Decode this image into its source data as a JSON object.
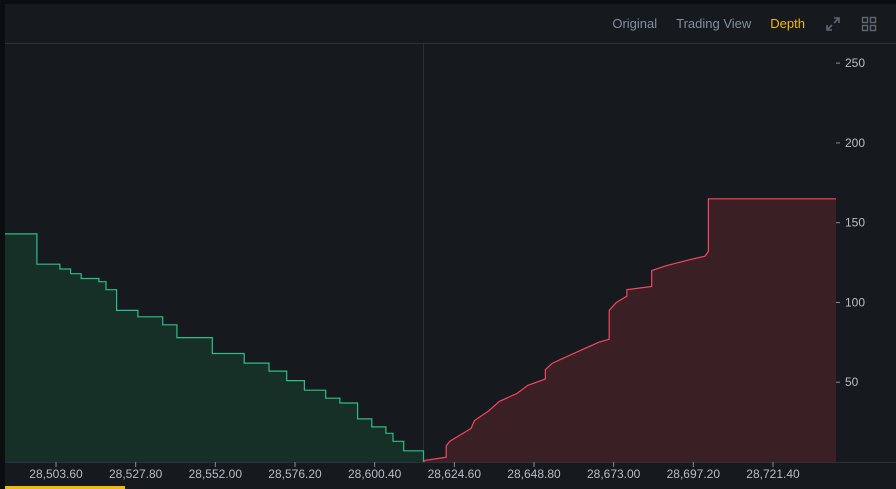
{
  "toolbar": {
    "tabs": [
      {
        "label": "Original",
        "active": false
      },
      {
        "label": "Trading View",
        "active": false
      },
      {
        "label": "Depth",
        "active": true
      }
    ],
    "icons": [
      "expand-icon",
      "grid-layout-icon"
    ]
  },
  "colors": {
    "background": "#161a1e",
    "bid_line": "#2ebd85",
    "bid_fill": "#163028",
    "ask_line": "#f6465d",
    "ask_fill": "#3a1f25",
    "accent": "#f0b90b"
  },
  "chart_data": {
    "type": "area",
    "title": "",
    "xlabel": "",
    "ylabel": "",
    "x_ticks": [
      "28,503.60",
      "28,527.80",
      "28,552.00",
      "28,576.20",
      "28,600.40",
      "28,624.60",
      "28,648.80",
      "28,673.00",
      "28,697.20",
      "28,721.40"
    ],
    "y_ticks": [
      50,
      100,
      150,
      200,
      250
    ],
    "xlim": [
      28495.5,
      28730.0
    ],
    "ylim": [
      0,
      262
    ],
    "mid_price": 28613.6,
    "grid": false,
    "series": [
      {
        "side": "bid",
        "points": [
          [
            28495.5,
            143
          ],
          [
            28504.5,
            143
          ],
          [
            28504.5,
            124
          ],
          [
            28511,
            124
          ],
          [
            28511,
            121
          ],
          [
            28514,
            121
          ],
          [
            28514,
            118
          ],
          [
            28517,
            118
          ],
          [
            28517,
            115
          ],
          [
            28522,
            115
          ],
          [
            28522,
            113
          ],
          [
            28524,
            113
          ],
          [
            28524,
            108
          ],
          [
            28527,
            108
          ],
          [
            28527,
            95
          ],
          [
            28533,
            95
          ],
          [
            28533,
            91
          ],
          [
            28540,
            91
          ],
          [
            28540,
            86
          ],
          [
            28544,
            86
          ],
          [
            28544,
            78
          ],
          [
            28554,
            78
          ],
          [
            28554,
            68
          ],
          [
            28563,
            68
          ],
          [
            28563,
            62
          ],
          [
            28570,
            62
          ],
          [
            28570,
            57
          ],
          [
            28575,
            57
          ],
          [
            28575,
            51
          ],
          [
            28580,
            51
          ],
          [
            28580,
            45
          ],
          [
            28586,
            45
          ],
          [
            28586,
            40
          ],
          [
            28590,
            40
          ],
          [
            28590,
            37
          ],
          [
            28595,
            37
          ],
          [
            28595,
            27
          ],
          [
            28599,
            27
          ],
          [
            28599,
            22
          ],
          [
            28603,
            22
          ],
          [
            28603,
            18
          ],
          [
            28605,
            18
          ],
          [
            28605,
            13
          ],
          [
            28608,
            13
          ],
          [
            28608,
            7
          ],
          [
            28613.6,
            7
          ],
          [
            28613.6,
            0
          ]
        ]
      },
      {
        "side": "ask",
        "points": [
          [
            28613.6,
            0
          ],
          [
            28614,
            1
          ],
          [
            28620,
            3
          ],
          [
            28620,
            10
          ],
          [
            28621,
            13
          ],
          [
            28624,
            17
          ],
          [
            28627,
            21
          ],
          [
            28628,
            26
          ],
          [
            28632,
            32
          ],
          [
            28635,
            38
          ],
          [
            28640,
            43
          ],
          [
            28643,
            48
          ],
          [
            28648,
            52
          ],
          [
            28648,
            58
          ],
          [
            28650,
            62
          ],
          [
            28655,
            67
          ],
          [
            28660,
            72
          ],
          [
            28663,
            75
          ],
          [
            28666,
            77
          ],
          [
            28666,
            95
          ],
          [
            28668,
            100
          ],
          [
            28671,
            104
          ],
          [
            28671,
            108
          ],
          [
            28678,
            110
          ],
          [
            28678,
            120
          ],
          [
            28682,
            123
          ],
          [
            28689,
            127
          ],
          [
            28693,
            129
          ],
          [
            28694,
            132
          ],
          [
            28694,
            165
          ],
          [
            28730,
            165
          ]
        ]
      }
    ]
  }
}
